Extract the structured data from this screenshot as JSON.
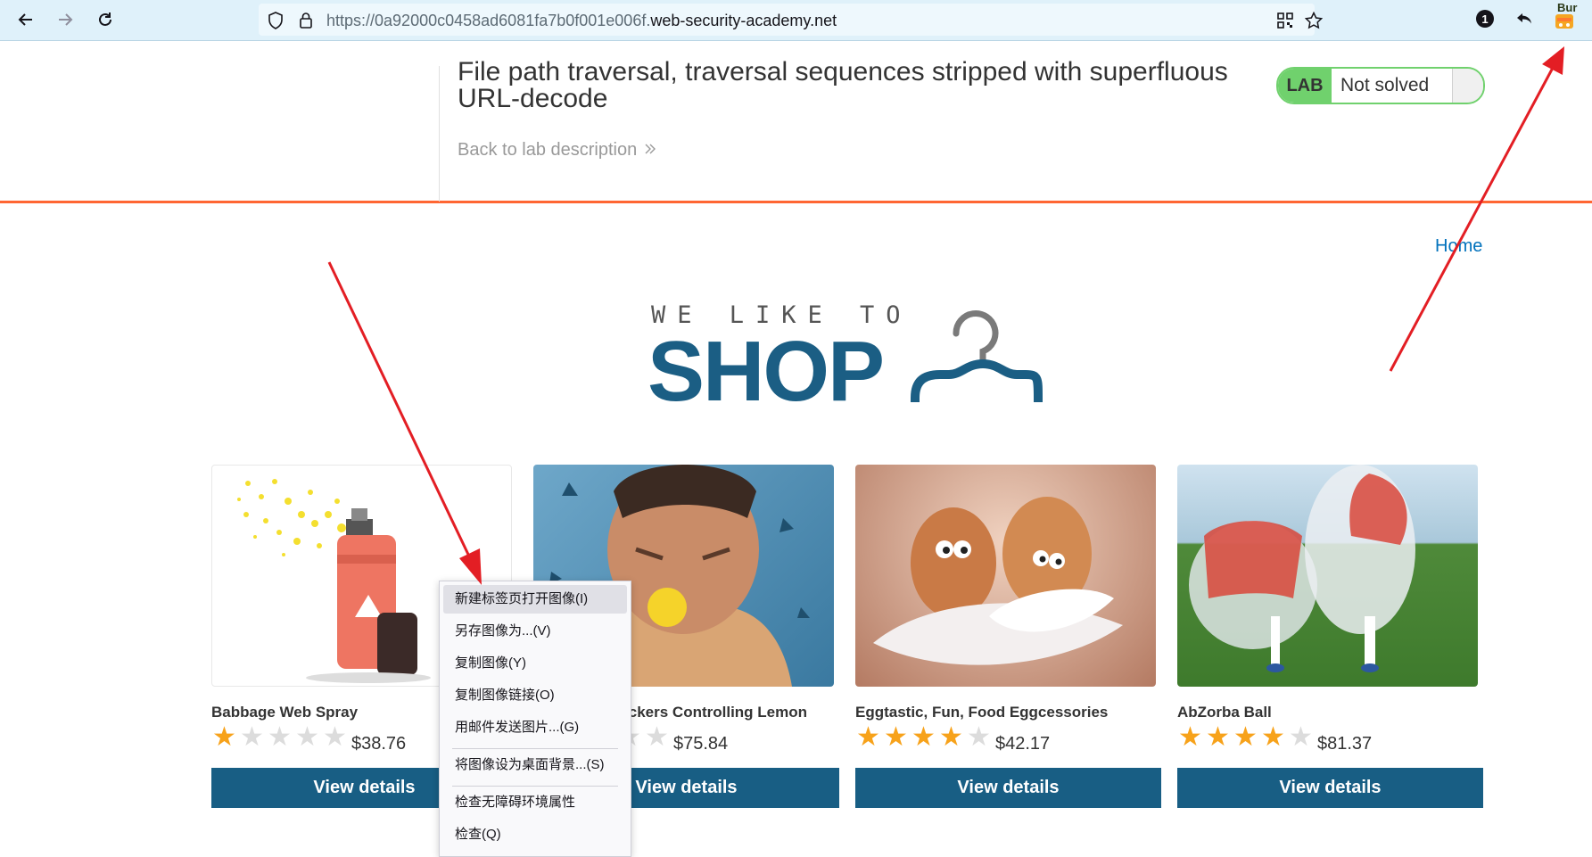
{
  "browser": {
    "url_prefix": "https://0a92000c0458ad6081fa7b0f001e006f.",
    "url_domain": "web-security-academy.net",
    "notification_count": "1",
    "extension_label": "Bur"
  },
  "lab": {
    "title": "File path traversal, traversal sequences stripped with superfluous URL-decode",
    "back_link": "Back to lab description",
    "badge": "LAB",
    "status": "Not solved"
  },
  "nav": {
    "home": "Home"
  },
  "logo": {
    "small": "WE LIKE TO",
    "big": "SHOP"
  },
  "products": [
    {
      "name": "Babbage Web Spray",
      "price": "$38.76",
      "rating": 1,
      "button": "View details"
    },
    {
      "name": "Hydrated Crackers Controlling Lemon",
      "price": "$75.84",
      "rating": 2,
      "button": "View details"
    },
    {
      "name": "Eggtastic, Fun, Food Eggcessories",
      "price": "$42.17",
      "rating": 4,
      "button": "View details"
    },
    {
      "name": "AbZorba Ball",
      "price": "$81.37",
      "rating": 4,
      "button": "View details"
    }
  ],
  "context_menu": {
    "items": [
      "新建标签页打开图像(I)",
      "另存图像为...(V)",
      "复制图像(Y)",
      "复制图像链接(O)",
      "用邮件发送图片...(G)",
      "将图像设为桌面背景...(S)",
      "检查无障碍环境属性",
      "检查(Q)"
    ]
  },
  "colors": {
    "accent_orange": "#ff6633",
    "brand_blue": "#185e84",
    "lab_green": "#70d16d",
    "star_gold": "#f7a21a",
    "star_empty": "#dcdcdc",
    "annotation_red": "#e31e24"
  }
}
